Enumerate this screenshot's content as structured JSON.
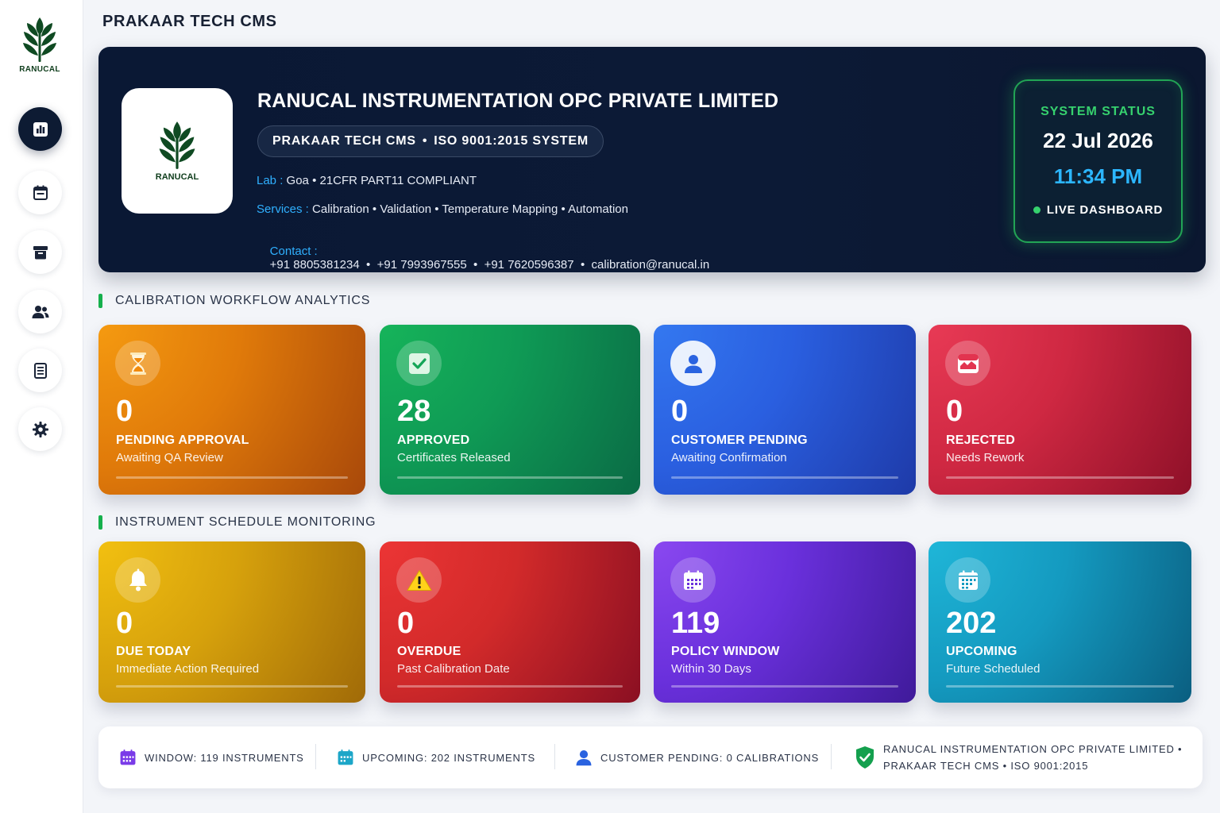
{
  "app": {
    "title": "PRAKAAR TECH CMS",
    "logo_text": "RANUCAL"
  },
  "sidebar": {
    "items": [
      {
        "name": "dashboard",
        "icon": "bar-chart-icon",
        "active": true
      },
      {
        "name": "calendar",
        "icon": "calendar-icon",
        "active": false
      },
      {
        "name": "archive",
        "icon": "archive-icon",
        "active": false
      },
      {
        "name": "customers",
        "icon": "users-icon",
        "active": false
      },
      {
        "name": "reports",
        "icon": "document-icon",
        "active": false
      },
      {
        "name": "settings",
        "icon": "gear-icon",
        "active": false
      }
    ]
  },
  "hero": {
    "logo_text": "RANUCAL",
    "company": "RANUCAL INSTRUMENTATION OPC PRIVATE LIMITED",
    "pill_left": "PRAKAAR TECH CMS",
    "pill_sep": "•",
    "pill_right": "ISO 9001:2015 SYSTEM",
    "lab_label": "Lab :",
    "lab_value": "Goa • 21CFR PART11 COMPLIANT",
    "services_label": "Services :",
    "services_value": "Calibration • Validation • Temperature Mapping • Automation",
    "contact_label": "Contact :",
    "contact_value": "+91 8805381234  •  +91 7993967555  •  +91 7620596387  •  calibration@ranucal.in",
    "status": {
      "title": "SYSTEM STATUS",
      "date": "22 Jul 2026",
      "time": "11:34 PM",
      "live": "LIVE DASHBOARD"
    }
  },
  "workflow": {
    "heading": "CALIBRATION WORKFLOW ANALYTICS",
    "cards": [
      {
        "value": "0",
        "title": "PENDING APPROVAL",
        "sub": "Awaiting QA Review",
        "icon": "hourglass-icon",
        "color": "#e8820c"
      },
      {
        "value": "28",
        "title": "APPROVED",
        "sub": "Certificates Released",
        "icon": "checkbox-icon",
        "color": "#14a05a"
      },
      {
        "value": "0",
        "title": "CUSTOMER PENDING",
        "sub": "Awaiting Confirmation",
        "icon": "user-icon",
        "color": "#2a63e0"
      },
      {
        "value": "0",
        "title": "REJECTED",
        "sub": "Needs Rework",
        "icon": "broken-image-icon",
        "color": "#d52a44"
      }
    ]
  },
  "schedule": {
    "heading": "INSTRUMENT SCHEDULE MONITORING",
    "cards": [
      {
        "value": "0",
        "title": "DUE TODAY",
        "sub": "Immediate Action Required",
        "icon": "bell-icon",
        "color": "#e0a810"
      },
      {
        "value": "0",
        "title": "OVERDUE",
        "sub": "Past Calibration Date",
        "icon": "warning-icon",
        "color": "#d82a2a"
      },
      {
        "value": "119",
        "title": "POLICY WINDOW",
        "sub": "Within 30 Days",
        "icon": "calendar-grid-icon",
        "color": "#7a3be8"
      },
      {
        "value": "202",
        "title": "UPCOMING",
        "sub": "Future Scheduled",
        "icon": "calendar-icon",
        "color": "#1ca6c8"
      }
    ]
  },
  "footer": {
    "window": "WINDOW: 119 INSTRUMENTS",
    "upcoming": "UPCOMING: 202 INSTRUMENTS",
    "customer": "CUSTOMER PENDING: 0 CALIBRATIONS",
    "company_line1": "RANUCAL INSTRUMENTATION OPC PRIVATE LIMITED •",
    "company_line2": "PRAKAAR TECH CMS • ISO 9001:2015"
  }
}
